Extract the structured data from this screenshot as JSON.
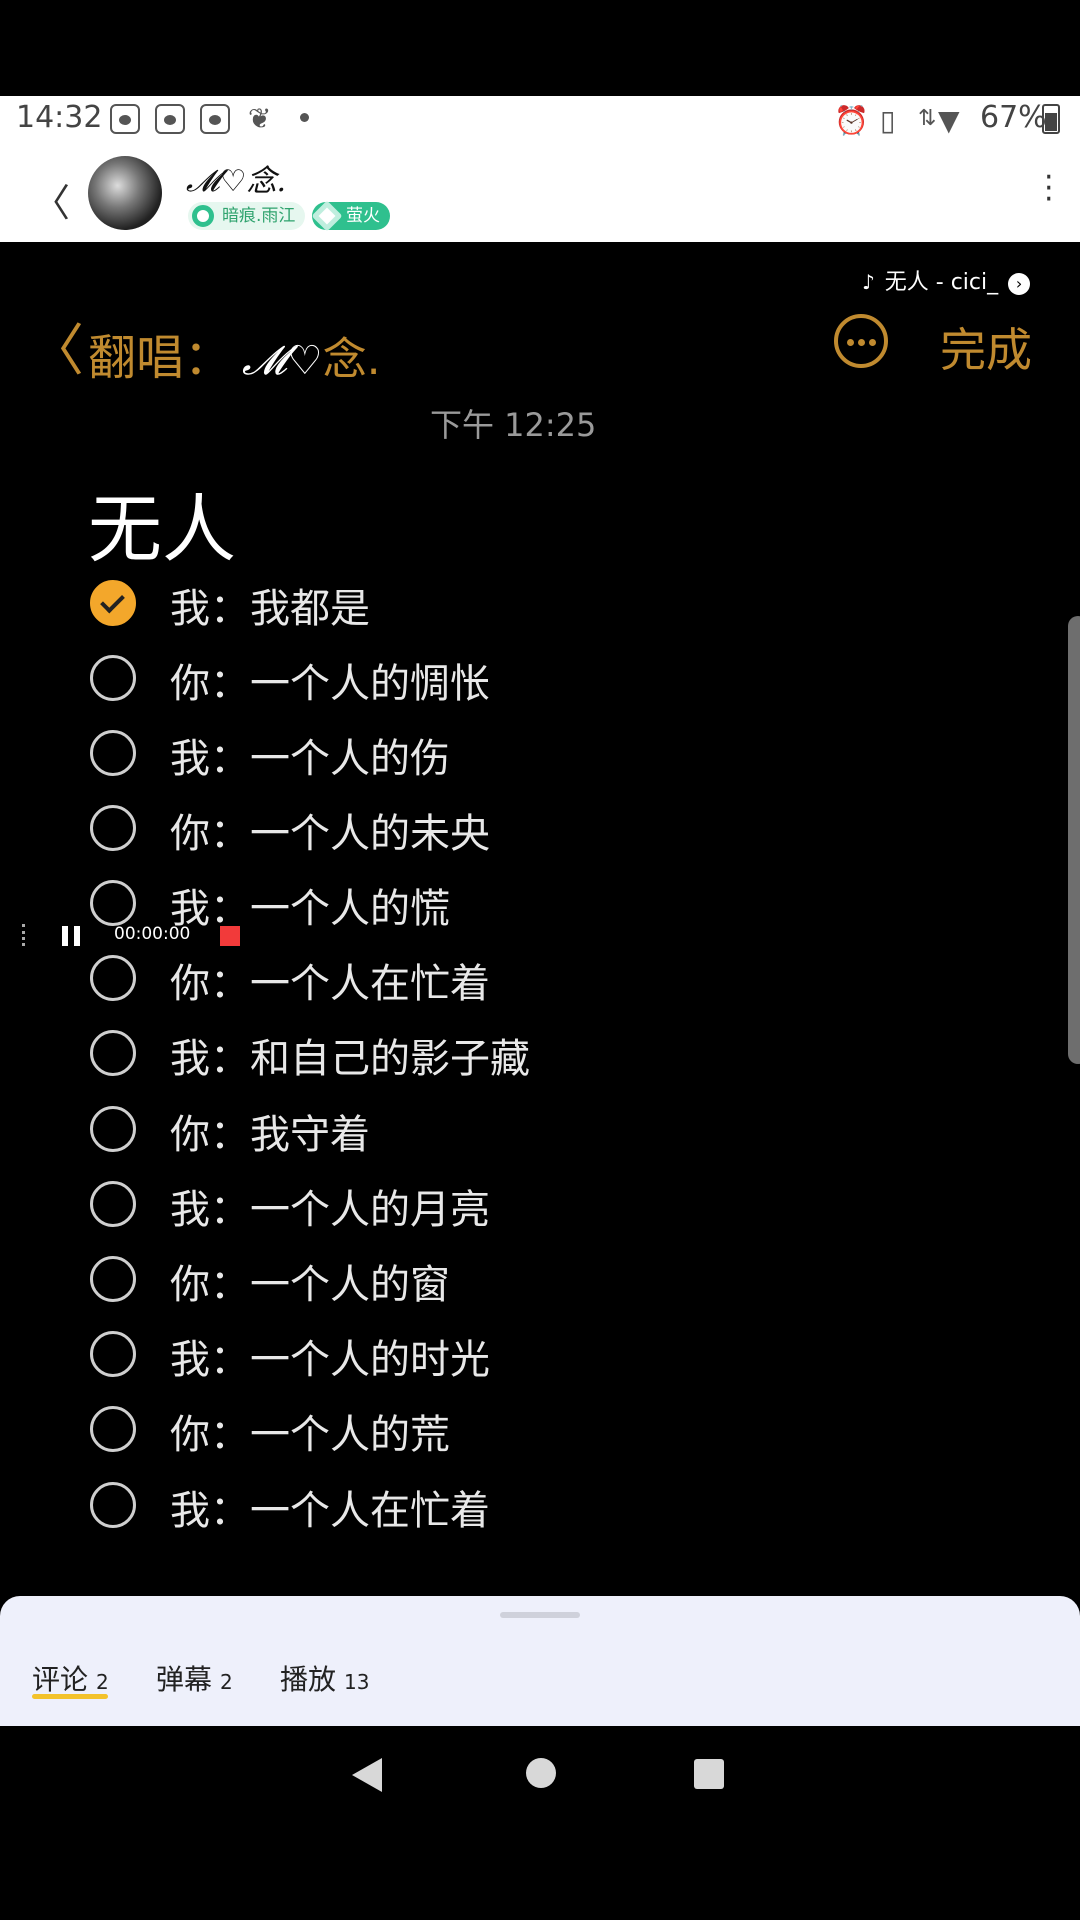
{
  "status_bar": {
    "time": "14:32",
    "battery": "67%",
    "icons": [
      "baidu-paw-icon",
      "baidu-paw-icon",
      "baidu-paw-icon",
      "app-notification-icon",
      "alarm-icon",
      "vibrate-icon",
      "data-arrows-icon",
      "wifi-icon",
      "battery-charging-icon"
    ]
  },
  "header": {
    "username": "𝓜♡念.",
    "badges": [
      "暗痕.雨江",
      "萤火"
    ]
  },
  "music": {
    "label": "无人 - cici_"
  },
  "note_nav": {
    "prefix": "翻唱：",
    "signature": "𝓜♡",
    "signature_end": "念.",
    "done": "完成"
  },
  "note": {
    "time": "下午 12:25",
    "title": "无人",
    "items": [
      {
        "text": "我：我都是",
        "checked": true
      },
      {
        "text": "你：一个人的惆怅",
        "checked": false
      },
      {
        "text": "我：一个人的伤",
        "checked": false
      },
      {
        "text": "你：一个人的未央",
        "checked": false
      },
      {
        "text": "我：一个人的慌",
        "checked": false
      },
      {
        "text": "你：一个人在忙着",
        "checked": false
      },
      {
        "text": "我：和自己的影子藏",
        "checked": false
      },
      {
        "text": "你：我守着",
        "checked": false
      },
      {
        "text": "我：一个人的月亮",
        "checked": false
      },
      {
        "text": "你：一个人的窗",
        "checked": false
      },
      {
        "text": "我：一个人的时光",
        "checked": false
      },
      {
        "text": "你：一个人的荒",
        "checked": false
      },
      {
        "text": "我：一个人在忙着",
        "checked": false
      }
    ]
  },
  "recorder": {
    "time": "00:00:00"
  },
  "bottom_tabs": [
    {
      "label": "评论",
      "count": "2",
      "active": true
    },
    {
      "label": "弹幕",
      "count": "2",
      "active": false
    },
    {
      "label": "播放",
      "count": "13",
      "active": false
    }
  ],
  "colors": {
    "accent": "#c08a2f",
    "check": "#f3a72b",
    "badge_green": "#2fc08e",
    "record_red": "#f23a3a"
  }
}
